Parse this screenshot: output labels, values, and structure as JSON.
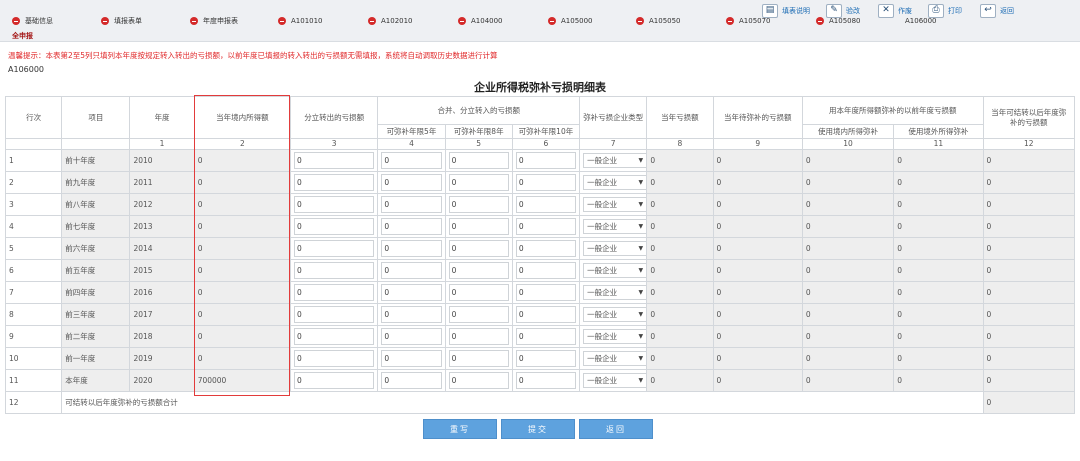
{
  "nav": {
    "tabs": [
      "基础信息",
      "填报表单",
      "年度申报表",
      "A101010",
      "A102010",
      "A104000",
      "A105000",
      "A105050",
      "A105070",
      "A105080",
      "A106000"
    ],
    "sub_tab": "全申报"
  },
  "toolbar": {
    "help": "填表说明",
    "check": "验改",
    "void": "作废",
    "print": "打印",
    "back": "返回"
  },
  "warning": "温馨提示：本表第2至5列只填列本年度按规定转入转出的亏损额，以前年度已填报的转入转出的亏损额无需填报，系统将自动调取历史数据进行计算",
  "form_code": "A106000",
  "title": "企业所得税弥补亏损明细表",
  "columns": {
    "row_no": "行次",
    "item": "项目",
    "year": "年度",
    "domestic_income": "当年境内所得额",
    "split_out_loss": "分立转出的亏损额",
    "merge_group": "合并、分立转入的亏损额",
    "limit5": "可弥补年限5年",
    "limit8": "可弥补年限8年",
    "limit10": "可弥补年限10年",
    "enterprise_type": "弥补亏损企业类型",
    "current_loss": "当年亏损额",
    "pending_loss": "当年待弥补的亏损额",
    "used_group": "用本年度所得额弥补的以前年度亏损额",
    "used_domestic": "使用境内所得弥补",
    "used_foreign": "使用境外所得弥补",
    "carry_forward": "当年可结转以后年度弥补的亏损额"
  },
  "col_index": [
    "1",
    "2",
    "3",
    "4",
    "5",
    "6",
    "7",
    "8",
    "9",
    "10",
    "11",
    "12"
  ],
  "rows": [
    {
      "no": "1",
      "item": "前十年度",
      "year": "2010",
      "income": "0",
      "split": "0",
      "l5": "0",
      "l8": "0",
      "l10": "0",
      "type": "一般企业",
      "loss": "0",
      "pending": "0",
      "dom": "0",
      "for": "0",
      "cf": "0"
    },
    {
      "no": "2",
      "item": "前九年度",
      "year": "2011",
      "income": "0",
      "split": "0",
      "l5": "0",
      "l8": "0",
      "l10": "0",
      "type": "一般企业",
      "loss": "0",
      "pending": "0",
      "dom": "0",
      "for": "0",
      "cf": "0"
    },
    {
      "no": "3",
      "item": "前八年度",
      "year": "2012",
      "income": "0",
      "split": "0",
      "l5": "0",
      "l8": "0",
      "l10": "0",
      "type": "一般企业",
      "loss": "0",
      "pending": "0",
      "dom": "0",
      "for": "0",
      "cf": "0"
    },
    {
      "no": "4",
      "item": "前七年度",
      "year": "2013",
      "income": "0",
      "split": "0",
      "l5": "0",
      "l8": "0",
      "l10": "0",
      "type": "一般企业",
      "loss": "0",
      "pending": "0",
      "dom": "0",
      "for": "0",
      "cf": "0"
    },
    {
      "no": "5",
      "item": "前六年度",
      "year": "2014",
      "income": "0",
      "split": "0",
      "l5": "0",
      "l8": "0",
      "l10": "0",
      "type": "一般企业",
      "loss": "0",
      "pending": "0",
      "dom": "0",
      "for": "0",
      "cf": "0"
    },
    {
      "no": "6",
      "item": "前五年度",
      "year": "2015",
      "income": "0",
      "split": "0",
      "l5": "0",
      "l8": "0",
      "l10": "0",
      "type": "一般企业",
      "loss": "0",
      "pending": "0",
      "dom": "0",
      "for": "0",
      "cf": "0"
    },
    {
      "no": "7",
      "item": "前四年度",
      "year": "2016",
      "income": "0",
      "split": "0",
      "l5": "0",
      "l8": "0",
      "l10": "0",
      "type": "一般企业",
      "loss": "0",
      "pending": "0",
      "dom": "0",
      "for": "0",
      "cf": "0"
    },
    {
      "no": "8",
      "item": "前三年度",
      "year": "2017",
      "income": "0",
      "split": "0",
      "l5": "0",
      "l8": "0",
      "l10": "0",
      "type": "一般企业",
      "loss": "0",
      "pending": "0",
      "dom": "0",
      "for": "0",
      "cf": "0"
    },
    {
      "no": "9",
      "item": "前二年度",
      "year": "2018",
      "income": "0",
      "split": "0",
      "l5": "0",
      "l8": "0",
      "l10": "0",
      "type": "一般企业",
      "loss": "0",
      "pending": "0",
      "dom": "0",
      "for": "0",
      "cf": "0"
    },
    {
      "no": "10",
      "item": "前一年度",
      "year": "2019",
      "income": "0",
      "split": "0",
      "l5": "0",
      "l8": "0",
      "l10": "0",
      "type": "一般企业",
      "loss": "0",
      "pending": "0",
      "dom": "0",
      "for": "0",
      "cf": "0"
    },
    {
      "no": "11",
      "item": "本年度",
      "year": "2020",
      "income": "700000",
      "split": "0",
      "l5": "0",
      "l8": "0",
      "l10": "0",
      "type": "一般企业",
      "loss": "0",
      "pending": "0",
      "dom": "0",
      "for": "0",
      "cf": "0"
    }
  ],
  "total_row": {
    "no": "12",
    "item": "可结转以后年度弥补的亏损额合计",
    "cf": "0"
  },
  "buttons": {
    "rewrite": "重写",
    "submit": "提交",
    "back": "返回"
  },
  "colors": {
    "warning": "#e0282a",
    "highlight_box": "#e23b3b",
    "button": "#5ea2de",
    "nav_dot": "#d42a2a"
  }
}
